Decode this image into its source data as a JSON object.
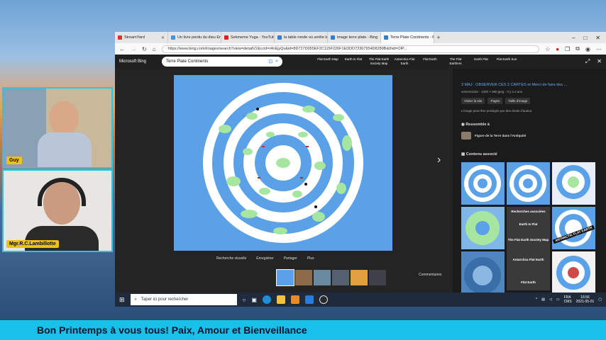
{
  "cams": [
    {
      "name": "Guy"
    },
    {
      "name": "Mgr.R.C.Lambillotte"
    }
  ],
  "browser": {
    "tabs": [
      {
        "label": "StreamYard",
        "color": "#e03030",
        "active": false
      },
      {
        "label": "Un livre perdu du dieu Enki",
        "color": "#4a90e2",
        "active": false
      },
      {
        "label": "Sekmeme Yuga - YouTube",
        "color": "#e02020",
        "active": false
      },
      {
        "label": "la table ronde où arrête le",
        "color": "#3a7bd5",
        "active": false
      },
      {
        "label": "image terre plate - Bing",
        "color": "#2a7fd4",
        "active": false
      },
      {
        "label": "Terre Plate Continents - Bing",
        "color": "#2a7fd4",
        "active": true
      }
    ],
    "new_tab": "+",
    "url": "https://www.bing.com/images/search?view=detailV2&ccid=r4nEjyQv&id=8D727D055EF2C115F226F1EDDD73367954D8280B&thid=OIP..."
  },
  "bing": {
    "logo": "Microsoft Bing",
    "query": "Terre Plate Continents",
    "chips": [
      "Flat Earth Map",
      "Earth Is Flat",
      "The Flat Earth Society Map",
      "Antarctica Flat Earth",
      "Flat Earth",
      "The Flat Earthers",
      "Earth Flat",
      "Flat Earth Sun"
    ],
    "actions": [
      "Recherche visuelle",
      "Enregistrer",
      "Partager",
      "Plus"
    ],
    "comments": "Commentaires"
  },
  "panel": {
    "title": "3 MAJ : OBSERVER CES 2 CARTES et Merci de faire des ...",
    "meta": "universocite  ·  1200 × 960 jpeg  ·  Il y a 2 ans",
    "buttons": [
      "Visiter la site",
      "Pages",
      "Taille d'image"
    ],
    "note": "L'image peut être protégée par des droits d'auteur.",
    "similar": "Ressemble à",
    "related_item": "Figure de la Terre dans l'Antiquité",
    "content": "Contenu associé",
    "grid_labels": [
      "Recherches associées",
      "Earth Is Flat",
      "The Flat Earth Society Map",
      "Antarctica Flat Earth",
      "Flat Earth",
      "ANTARCTIC FLAT EARTH"
    ]
  },
  "taskbar": {
    "search_placeholder": "Taper ici pour rechercher",
    "lang": "FRA\nCMS",
    "time": "16:56",
    "date": "2021-05-01"
  },
  "banner": "Bon Printemps à vous tous! Paix, Amour et Bienveillance",
  "colors": {
    "accent": "#2bc7e0",
    "banner": "#18c0ea",
    "map_ocean": "#5aa1e8",
    "map_land": "#a6e6a0"
  }
}
